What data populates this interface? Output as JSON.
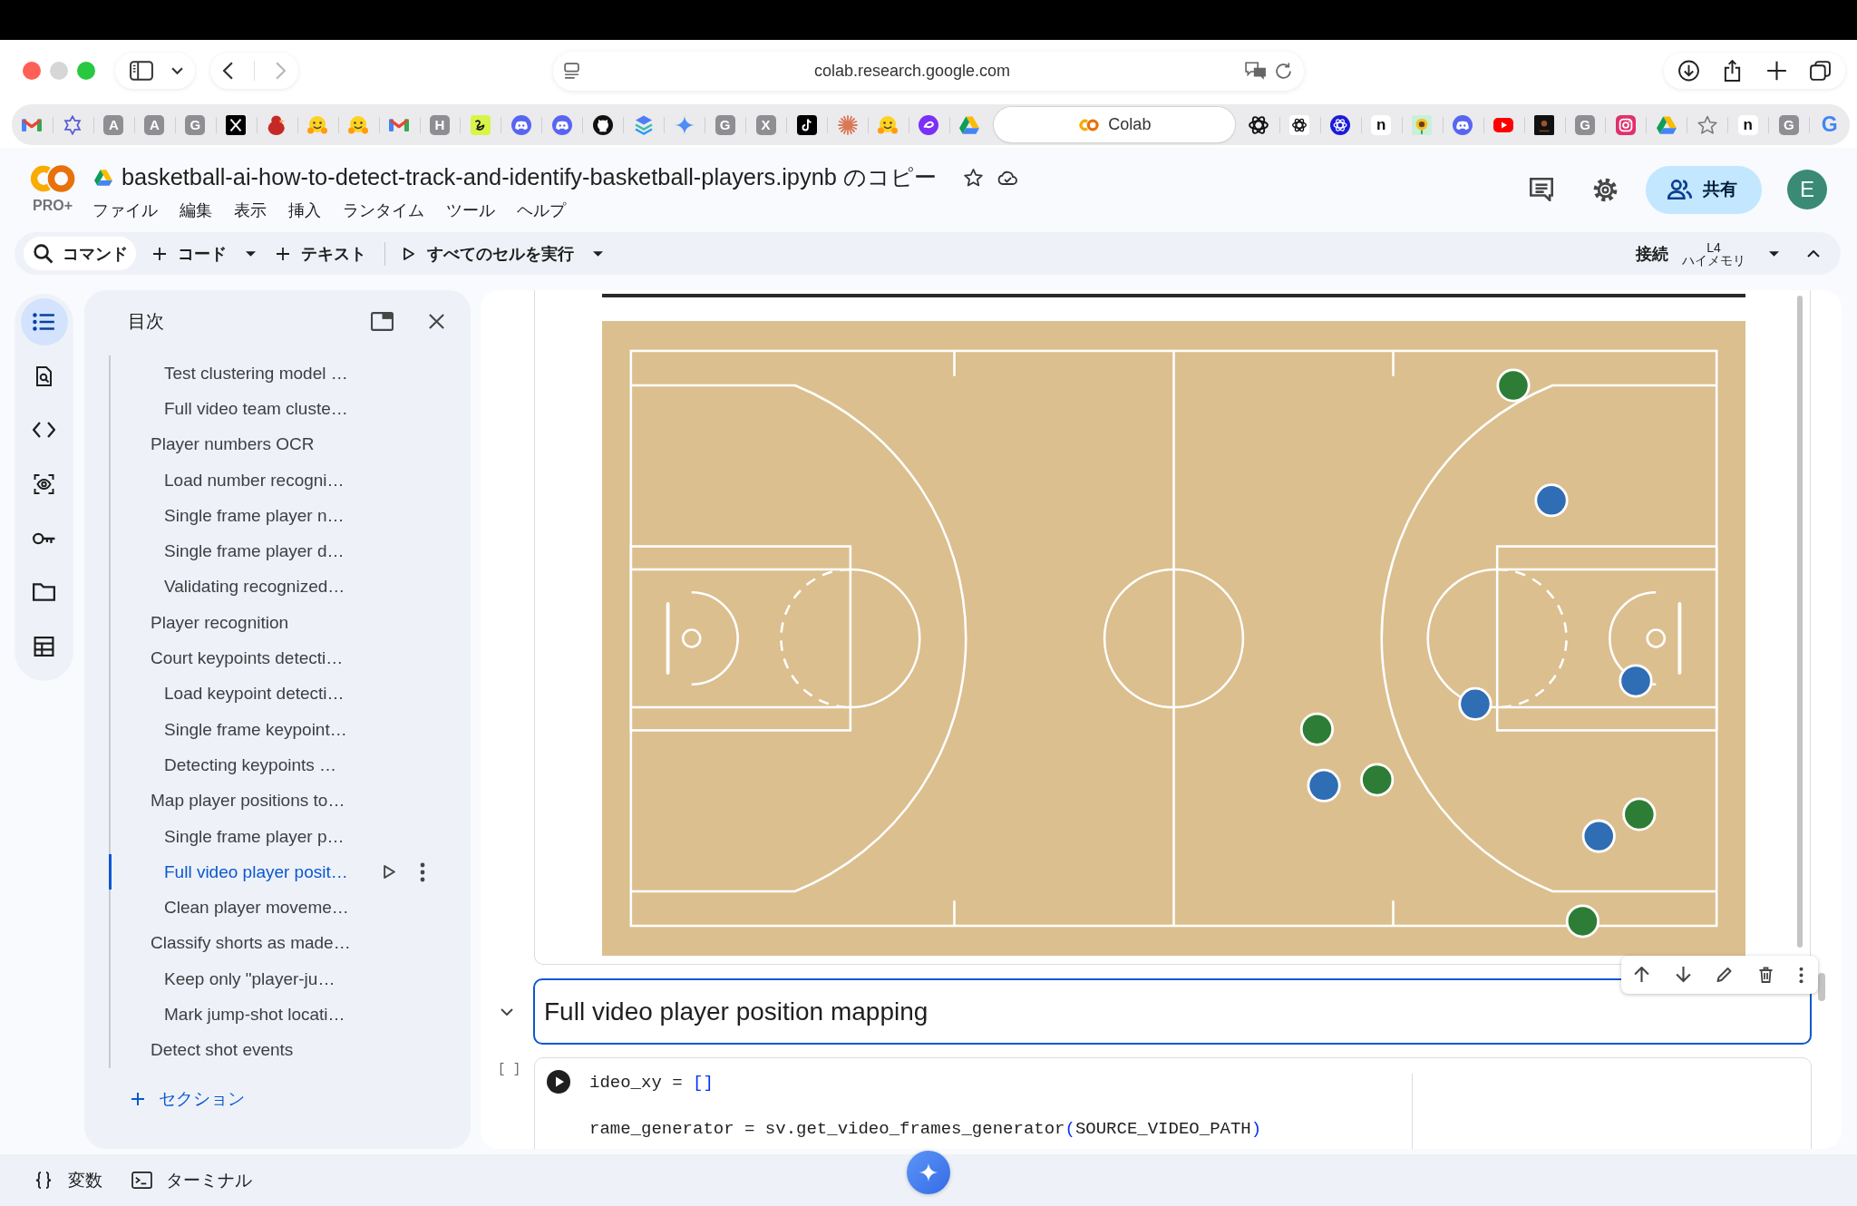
{
  "browser": {
    "window_controls": [
      {
        "kind": "close",
        "disabled": false
      },
      {
        "kind": "minimize",
        "disabled": true
      },
      {
        "kind": "zoom",
        "disabled": false
      }
    ],
    "navigation": [
      {
        "kind": "back",
        "disabled": false
      },
      {
        "kind": "forward",
        "disabled": true
      }
    ],
    "address": "colab.research.google.com",
    "tabs": [
      {
        "kind": "mail",
        "selected": false
      },
      {
        "kind": "star-knot",
        "selected": false
      },
      {
        "kind": "letter",
        "text": "A",
        "selected": false
      },
      {
        "kind": "letter",
        "text": "A",
        "selected": false
      },
      {
        "kind": "letter",
        "text": "G",
        "selected": false
      },
      {
        "kind": "x-logo",
        "selected": false
      },
      {
        "kind": "bird",
        "selected": false
      },
      {
        "kind": "smiley",
        "selected": false
      },
      {
        "kind": "smiley",
        "selected": false
      },
      {
        "kind": "mail",
        "selected": false
      },
      {
        "kind": "letter",
        "text": "H",
        "selected": false
      },
      {
        "kind": "squiggle",
        "selected": false
      },
      {
        "kind": "controller",
        "selected": false
      },
      {
        "kind": "controller",
        "selected": false
      },
      {
        "kind": "cat",
        "selected": false
      },
      {
        "kind": "layers",
        "selected": false
      },
      {
        "kind": "sparkle",
        "selected": false
      },
      {
        "kind": "letter",
        "text": "G",
        "selected": false
      },
      {
        "kind": "letter",
        "text": "X",
        "selected": false
      },
      {
        "kind": "note",
        "selected": false
      },
      {
        "kind": "asterisk",
        "selected": false
      },
      {
        "kind": "smiley",
        "selected": false
      },
      {
        "kind": "swirl",
        "selected": false
      },
      {
        "kind": "triangle",
        "selected": false
      },
      {
        "kind": "page",
        "title": "Colab",
        "selected": true
      },
      {
        "kind": "knot",
        "selected": false
      },
      {
        "kind": "knot-tile",
        "selected": false
      },
      {
        "kind": "knot-disc",
        "selected": false
      },
      {
        "kind": "letter-plain",
        "text": "n",
        "selected": false
      },
      {
        "kind": "flower",
        "selected": false
      },
      {
        "kind": "controller",
        "selected": false
      },
      {
        "kind": "video",
        "selected": false
      },
      {
        "kind": "dark-tile",
        "selected": false
      },
      {
        "kind": "letter",
        "text": "G",
        "selected": false
      },
      {
        "kind": "camera",
        "selected": false
      },
      {
        "kind": "triangle",
        "selected": false
      },
      {
        "kind": "star",
        "selected": false
      },
      {
        "kind": "letter-plain",
        "text": "n",
        "selected": false
      },
      {
        "kind": "letter",
        "text": "G",
        "selected": false
      },
      {
        "kind": "letter-color",
        "text": "G",
        "selected": false
      }
    ]
  },
  "notebook": {
    "plan": "PRO+",
    "title": "basketball-ai-how-to-detect-track-and-identify-basketball-players.ipynb のコピー",
    "menu": [
      "ファイル",
      "編集",
      "表示",
      "挿入",
      "ランタイム",
      "ツール",
      "ヘルプ"
    ],
    "share_label": "共有",
    "avatar_letter": "E"
  },
  "toolbar": {
    "command": "コマンド",
    "add_code": "コード",
    "add_text": "テキスト",
    "run_all": "すべてのセルを実行",
    "connect": "接続",
    "accelerator": "L4",
    "memory": "ハイメモリ"
  },
  "rail": [
    {
      "kind": "toc",
      "selected": true
    },
    {
      "kind": "find",
      "selected": false
    },
    {
      "kind": "snippets",
      "selected": false
    },
    {
      "kind": "inspect",
      "selected": false
    },
    {
      "kind": "secrets",
      "selected": false
    },
    {
      "kind": "files",
      "selected": false
    },
    {
      "kind": "data",
      "selected": false
    }
  ],
  "toc": {
    "title": "目次",
    "continued_children": [
      {
        "label": "Test clustering model …",
        "selected": false
      },
      {
        "label": "Full video team cluste…",
        "selected": false
      }
    ],
    "items": [
      {
        "label": "Player numbers OCR",
        "selected": false,
        "children": [
          {
            "label": "Load number recogni…",
            "selected": false
          },
          {
            "label": "Single frame player n…",
            "selected": false
          },
          {
            "label": "Single frame player d…",
            "selected": false
          },
          {
            "label": "Validating recognized…",
            "selected": false
          }
        ]
      },
      {
        "label": "Player recognition",
        "selected": false
      },
      {
        "label": "Court keypoints detecti…",
        "selected": false,
        "children": [
          {
            "label": "Load keypoint detecti…",
            "selected": false
          },
          {
            "label": "Single frame keypoint…",
            "selected": false
          },
          {
            "label": "Detecting keypoints …",
            "selected": false
          }
        ]
      },
      {
        "label": "Map player positions to…",
        "selected": false,
        "children": [
          {
            "label": "Single frame player p…",
            "selected": false
          },
          {
            "label": "Full video player posit…",
            "selected": true
          },
          {
            "label": "Clean player moveme…",
            "selected": false
          }
        ]
      },
      {
        "label": "Classify shorts as made…",
        "selected": false,
        "children": [
          {
            "label": "Keep only \"player-ju…",
            "selected": false
          },
          {
            "label": "Mark jump-shot locati…",
            "selected": false
          }
        ]
      },
      {
        "label": "Detect shot events",
        "selected": false
      }
    ],
    "add_section": "セクション"
  },
  "cells": [
    {
      "kind": "output-image",
      "selected": false
    },
    {
      "kind": "heading",
      "text": "Full video player position mapping",
      "expanded": true,
      "selected": true
    },
    {
      "kind": "code",
      "exec_count": "[ ]",
      "selected": false,
      "lines": [
        {
          "tokens": [
            {
              "kind": "plain",
              "text": "ideo_xy = "
            },
            {
              "kind": "bracket",
              "text": "[]"
            }
          ]
        },
        {
          "tokens": [
            {
              "kind": "plain",
              "text": "rame_generator = sv.get_video_frames_generator"
            },
            {
              "kind": "bracket",
              "text": "("
            },
            {
              "kind": "plain",
              "text": "SOURCE_VIDEO_PATH"
            },
            {
              "kind": "bracket",
              "text": ")"
            }
          ]
        }
      ]
    }
  ],
  "bottom_bar": {
    "variables": "変数",
    "terminal": "ターミナル"
  }
}
